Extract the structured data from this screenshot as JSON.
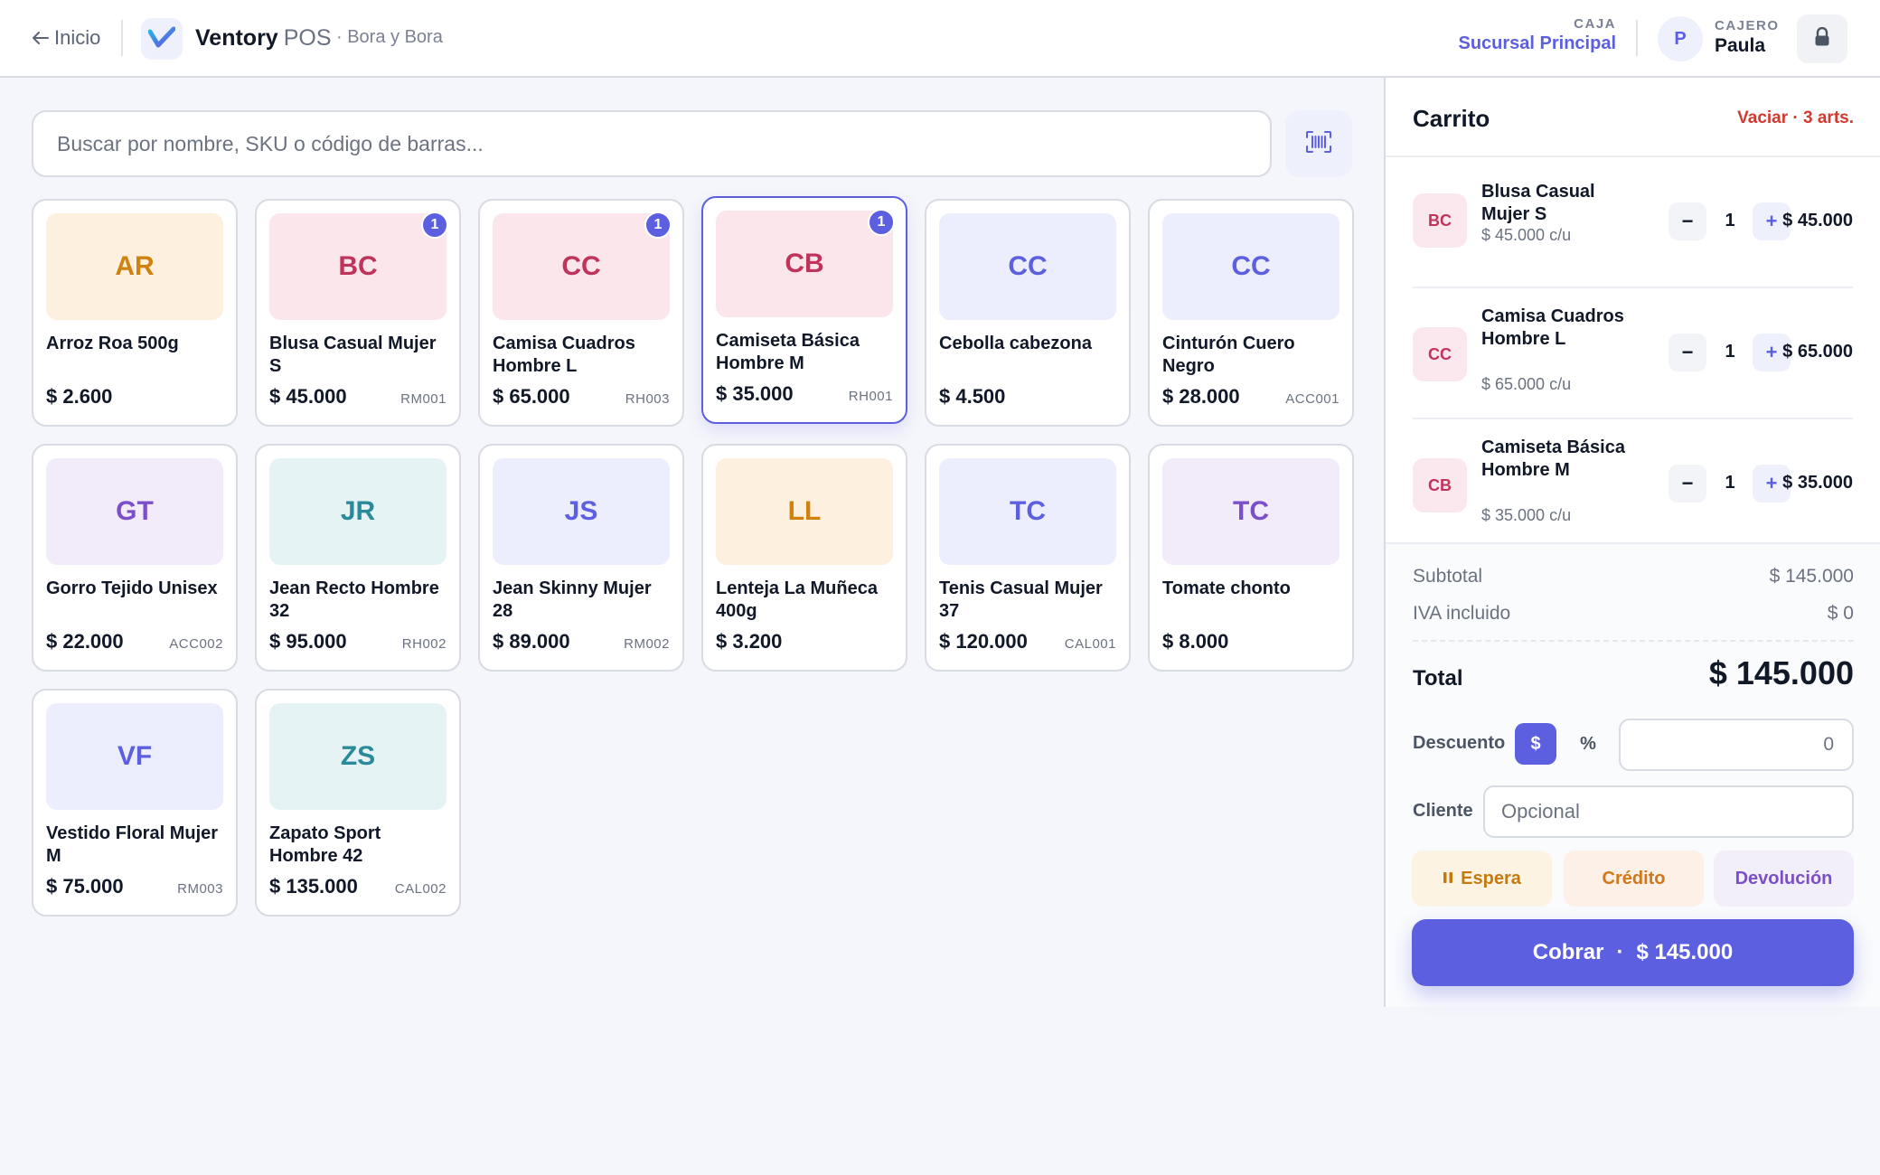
{
  "header": {
    "back_label": "Inicio",
    "brand_name": "Ventory",
    "brand_suffix": "POS",
    "store_label": "· Bora y Bora",
    "caja_label": "CAJA",
    "caja_value": "Sucursal Principal",
    "cajero_initial": "P",
    "cajero_label": "CAJERO",
    "cajero_name": "Paula"
  },
  "search": {
    "placeholder": "Buscar por nombre, SKU o código de barras..."
  },
  "products": [
    {
      "initials": "AR",
      "name": "Arroz Roa 500g",
      "price": "$ 2.600",
      "sku": "",
      "badge": "",
      "tone": "orange"
    },
    {
      "initials": "BC",
      "name": "Blusa Casual Mujer S",
      "price": "$ 45.000",
      "sku": "RM001",
      "badge": "1",
      "tone": "pink"
    },
    {
      "initials": "CC",
      "name": "Camisa Cuadros Hombre L",
      "price": "$ 65.000",
      "sku": "RH003",
      "badge": "1",
      "tone": "pink"
    },
    {
      "initials": "CB",
      "name": "Camiseta Básica Hombre M",
      "price": "$ 35.000",
      "sku": "RH001",
      "badge": "1",
      "tone": "pink",
      "selected": true
    },
    {
      "initials": "CC",
      "name": "Cebolla cabezona",
      "price": "$ 4.500",
      "sku": "",
      "badge": "",
      "tone": "indigo"
    },
    {
      "initials": "CC",
      "name": "Cinturón Cuero Negro",
      "price": "$ 28.000",
      "sku": "ACC001",
      "badge": "",
      "tone": "indigo"
    },
    {
      "initials": "GT",
      "name": "Gorro Tejido Unisex",
      "price": "$ 22.000",
      "sku": "ACC002",
      "badge": "",
      "tone": "purple"
    },
    {
      "initials": "JR",
      "name": "Jean Recto Hombre 32",
      "price": "$ 95.000",
      "sku": "RH002",
      "badge": "",
      "tone": "teal"
    },
    {
      "initials": "JS",
      "name": "Jean Skinny Mujer 28",
      "price": "$ 89.000",
      "sku": "RM002",
      "badge": "",
      "tone": "indigo"
    },
    {
      "initials": "LL",
      "name": "Lenteja La Muñeca 400g",
      "price": "$ 3.200",
      "sku": "",
      "badge": "",
      "tone": "orange"
    },
    {
      "initials": "TC",
      "name": "Tenis Casual Mujer 37",
      "price": "$ 120.000",
      "sku": "CAL001",
      "badge": "",
      "tone": "indigo"
    },
    {
      "initials": "TC",
      "name": "Tomate chonto",
      "price": "$ 8.000",
      "sku": "",
      "badge": "",
      "tone": "purple"
    },
    {
      "initials": "VF",
      "name": "Vestido Floral Mujer M",
      "price": "$ 75.000",
      "sku": "RM003",
      "badge": "",
      "tone": "indigo"
    },
    {
      "initials": "ZS",
      "name": "Zapato Sport Hombre 42",
      "price": "$ 135.000",
      "sku": "CAL002",
      "badge": "",
      "tone": "teal"
    }
  ],
  "tones": {
    "orange": {
      "bg": "#fdf0df",
      "fg": "#d0820f"
    },
    "pink": {
      "bg": "#fbe6ec",
      "fg": "#c0335b"
    },
    "indigo": {
      "bg": "#eceefd",
      "fg": "#5b5fe0"
    },
    "purple": {
      "bg": "#f2ecfa",
      "fg": "#7b4fc9"
    },
    "teal": {
      "bg": "#e6f3f4",
      "fg": "#2a8a9a"
    }
  },
  "cart": {
    "title": "Carrito",
    "clear_label": "Vaciar · 3 arts.",
    "items": [
      {
        "initials": "BC",
        "name": "Blusa Casual Mujer S",
        "unit": "$ 45.000 c/u",
        "qty": "1",
        "total": "$ 45.000"
      },
      {
        "initials": "CC",
        "name": "Camisa Cuadros Hombre L",
        "unit": "$ 65.000 c/u",
        "qty": "1",
        "total": "$ 65.000"
      },
      {
        "initials": "CB",
        "name": "Camiseta Básica Hombre M",
        "unit": "$ 35.000 c/u",
        "qty": "1",
        "total": "$ 35.000"
      }
    ],
    "minus_label": "−",
    "plus_label": "+",
    "subtotal_label": "Subtotal",
    "subtotal_value": "$ 145.000",
    "iva_label": "IVA incluido",
    "iva_value": "$ 0",
    "total_label": "Total",
    "total_value": "$ 145.000",
    "discount_label": "Descuento",
    "discount_dollar": "$",
    "discount_pct": "%",
    "discount_value": "0",
    "client_label": "Cliente",
    "client_placeholder": "Opcional",
    "hold_label": "Espera",
    "credit_label": "Crédito",
    "return_label": "Devolución",
    "charge_label": "Cobrar",
    "charge_sep": "·",
    "charge_amount": "$ 145.000"
  },
  "colors": {
    "accent": "#5b5fe0",
    "danger": "#d23a2f"
  }
}
